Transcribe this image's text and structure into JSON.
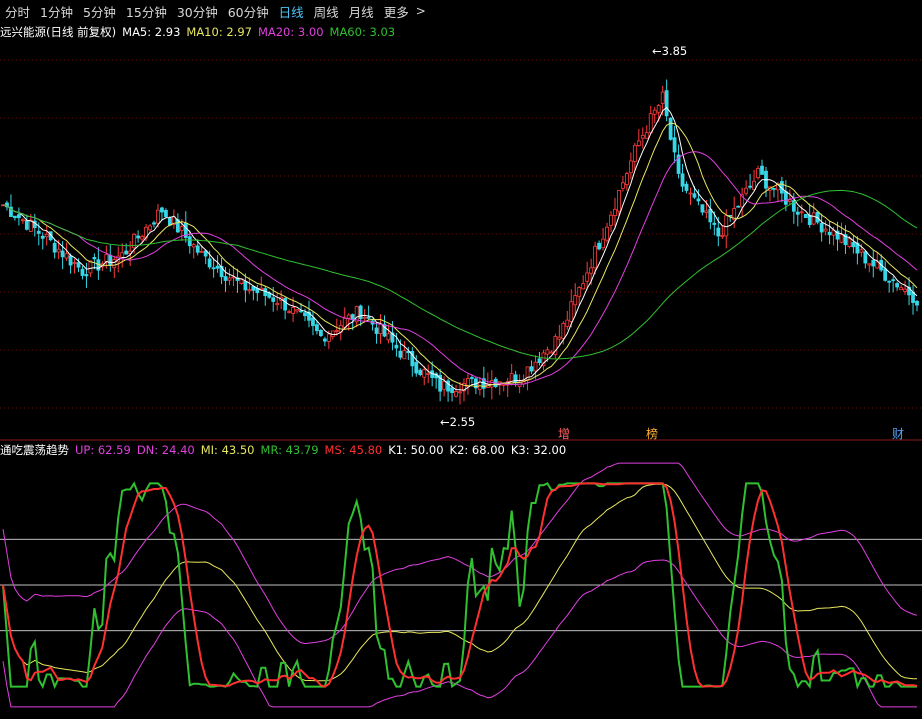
{
  "toolbar": {
    "periods": [
      {
        "label": "分时",
        "active": false
      },
      {
        "label": "1分钟",
        "active": false
      },
      {
        "label": "5分钟",
        "active": false
      },
      {
        "label": "15分钟",
        "active": false
      },
      {
        "label": "30分钟",
        "active": false
      },
      {
        "label": "60分钟",
        "active": false
      },
      {
        "label": "日线",
        "active": true
      },
      {
        "label": "周线",
        "active": false
      },
      {
        "label": "月线",
        "active": false
      },
      {
        "label": "更多",
        "active": false
      }
    ],
    "more_icon": "chevron-right-icon"
  },
  "main_panel": {
    "title": "远兴能源(日线 前复权)",
    "ma": [
      {
        "label": "MA5: 2.93",
        "color": "#ffffff"
      },
      {
        "label": "MA10: 2.97",
        "color": "#e8e860"
      },
      {
        "label": "MA20: 3.00",
        "color": "#e040e0"
      },
      {
        "label": "MA60: 3.03",
        "color": "#30c030"
      }
    ],
    "high_label": "3.85",
    "low_label": "2.55",
    "event_badges": [
      {
        "text": "增",
        "color": "#ff6060"
      },
      {
        "text": "榜",
        "color": "#ffb030"
      },
      {
        "text": "财",
        "color": "#4fa3ff"
      }
    ]
  },
  "indicator_panel": {
    "title": "通吃震荡趋势",
    "values": [
      {
        "label": "UP: 62.59",
        "color": "#e040e0"
      },
      {
        "label": "DN: 24.40",
        "color": "#e040e0"
      },
      {
        "label": "MI: 43.50",
        "color": "#e8e860"
      },
      {
        "label": "MR: 43.79",
        "color": "#30c030"
      },
      {
        "label": "MS: 45.80",
        "color": "#ff3030"
      },
      {
        "label": "K1: 50.00",
        "color": "#ffffff"
      },
      {
        "label": "K2: 68.00",
        "color": "#ffffff"
      },
      {
        "label": "K3: 32.00",
        "color": "#ffffff"
      }
    ]
  },
  "chart_data": [
    {
      "type": "candlestick",
      "ylim": [
        2.45,
        3.95
      ],
      "ma_names": [
        "MA5",
        "MA10",
        "MA20",
        "MA60"
      ],
      "close_keyframes": [
        [
          0,
          3.3
        ],
        [
          10,
          3.18
        ],
        [
          20,
          3.04
        ],
        [
          30,
          3.1
        ],
        [
          40,
          3.28
        ],
        [
          50,
          3.1
        ],
        [
          60,
          2.98
        ],
        [
          70,
          2.92
        ],
        [
          80,
          2.78
        ],
        [
          90,
          2.88
        ],
        [
          100,
          2.72
        ],
        [
          110,
          2.58
        ],
        [
          120,
          2.6
        ],
        [
          130,
          2.62
        ],
        [
          140,
          2.78
        ],
        [
          150,
          3.15
        ],
        [
          160,
          3.55
        ],
        [
          166,
          3.72
        ],
        [
          170,
          3.4
        ],
        [
          180,
          3.18
        ],
        [
          190,
          3.42
        ],
        [
          200,
          3.28
        ],
        [
          210,
          3.18
        ],
        [
          220,
          3.05
        ],
        [
          230,
          2.93
        ]
      ]
    },
    {
      "type": "line",
      "ylim": [
        0,
        100
      ],
      "reference_lines": [
        50,
        68,
        32
      ],
      "series_names": [
        "UP",
        "DN",
        "MI",
        "MR",
        "MS"
      ]
    }
  ]
}
